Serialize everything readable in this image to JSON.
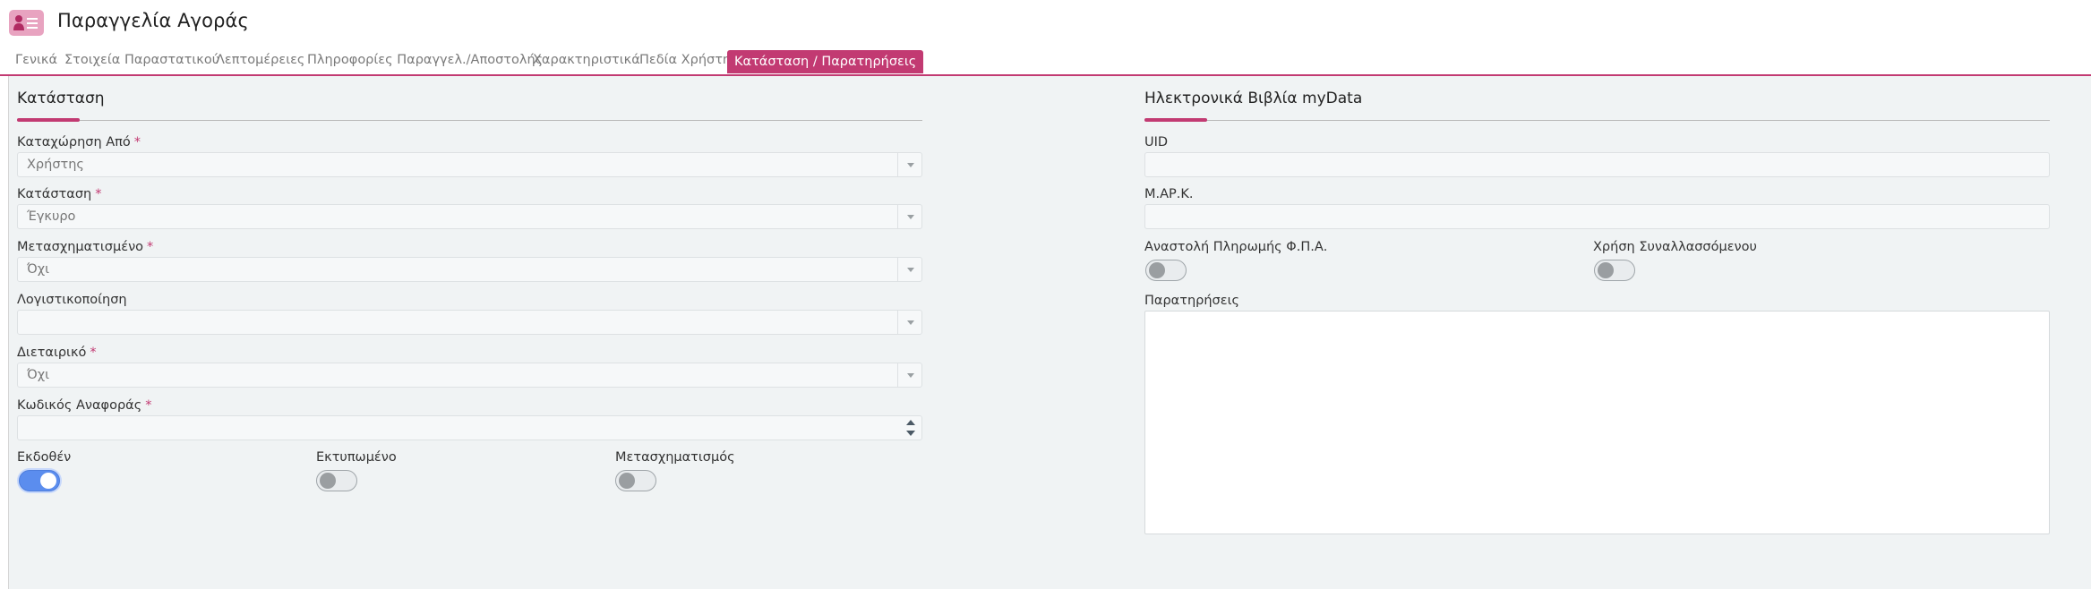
{
  "header": {
    "title": "Παραγγελία Αγοράς",
    "icon": "user-card-icon"
  },
  "tabs": [
    {
      "label": "Γενικά"
    },
    {
      "label": "Στοιχεία Παραστατικού"
    },
    {
      "label": "Λεπτομέρειες"
    },
    {
      "label": "Πληροφορίες Παραγγελ./Αποστολής"
    },
    {
      "label": "Χαρακτηριστικά"
    },
    {
      "label": "Πεδία Χρήστη"
    },
    {
      "label": "Κατάσταση / Παρατηρήσεις"
    }
  ],
  "status_section": {
    "title": "Κατάσταση",
    "fields": [
      {
        "label": "Καταχώρηση Από",
        "value": "Χρήστης"
      },
      {
        "label": "Κατάσταση",
        "value": "Έγκυρο"
      },
      {
        "label": "Μετασχηματισμένο",
        "value": "Όχι"
      },
      {
        "label": "Λογιστικοποίηση",
        "value": ""
      },
      {
        "label": "Διεταιρικό",
        "value": "Όχι"
      },
      {
        "label": "Κωδικός Αναφοράς",
        "value": ""
      }
    ],
    "required_mark": "*",
    "toggles": [
      {
        "label": "Εκδοθέν",
        "on": true
      },
      {
        "label": "Εκτυπωμένο",
        "on": false
      },
      {
        "label": "Μετασχηματισμός",
        "on": false
      }
    ]
  },
  "mydata_section": {
    "title": "Ηλεκτρονικά Βιβλία myData",
    "uid_label": "UID",
    "uid_value": "",
    "mark_label": "Μ.ΑΡ.Κ.",
    "mark_value": "",
    "toggles": [
      {
        "label": "Αναστολή Πληρωμής Φ.Π.Α.",
        "on": false
      },
      {
        "label": "Χρήση Συναλλασσόμενου",
        "on": false
      }
    ],
    "notes_label": "Παρατηρήσεις",
    "notes_value": ""
  },
  "colors": {
    "accent": "#c23a72",
    "toggle_on": "#5b8dee",
    "background": "#f0f3f4"
  }
}
